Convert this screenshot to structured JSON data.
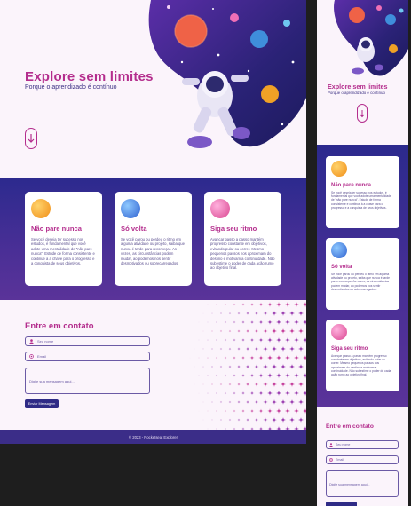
{
  "hero": {
    "title": "Explore sem limites",
    "subtitle": "Porque o aprendizado é contínuo"
  },
  "cards": [
    {
      "title": "Não pare nunca",
      "text": "Se você deseja ter sucesso nos estudos, é fundamental que você adote uma mentalidade de \"não pare nunca\". Estude de forma consistente e continue à a chave para o progresso e a conquista de seus objetivos.",
      "planet": "orange-planet-icon"
    },
    {
      "title": "Só volta",
      "text": "Se você parou ou perdeu o ritmo em alguma atividade ou projeto, saiba que nunca é tarde para recomeçar. As vezes, as circunstâncias podem mudar, ao podemos nos sentir desmotivados ou sobrecarregados.",
      "planet": "blue-planet-icon"
    },
    {
      "title": "Siga seu ritmo",
      "text": "Avançar passo a passo mantém progresso constante em objetivos, evitando pular ou correr. Mesmo pequenos passos nos aproximam do destino e motivam a continuidade. Não subestime o poder de cada ação rumo ao objetivo final.",
      "planet": "pink-planet-icon"
    }
  ],
  "contact": {
    "title": "Entre em contato",
    "name_placeholder": "Seu nome",
    "email_placeholder": "Email",
    "message_placeholder": "Digite sua mensagem aqui...",
    "send_label": "Enviar Mensagem"
  },
  "footer": {
    "text": "© 2023 - Rocketseat Explorer"
  },
  "colors": {
    "accent": "#b42d8d",
    "primary": "#2f2b86",
    "background": "#fbf4fb"
  }
}
